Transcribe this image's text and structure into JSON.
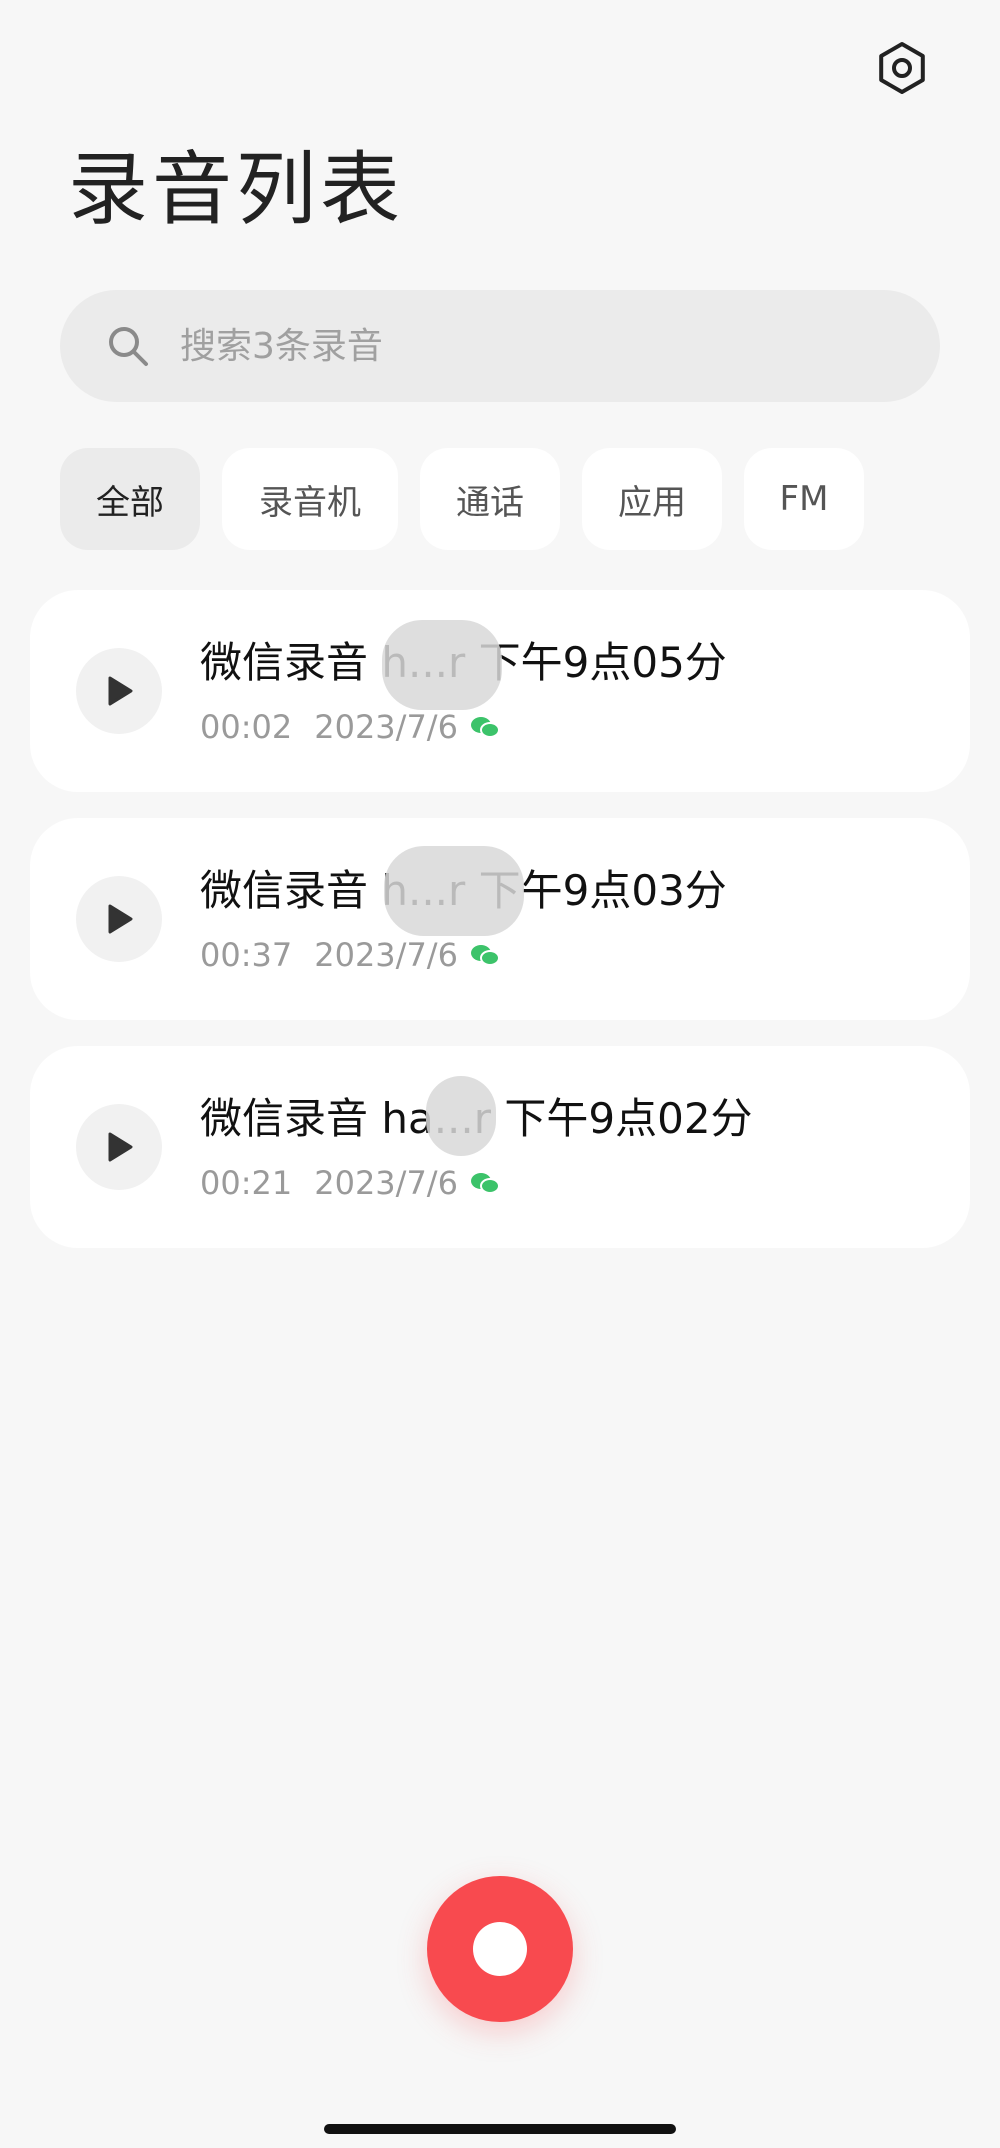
{
  "header": {
    "title": "录音列表",
    "settings_icon": "gear-icon"
  },
  "search": {
    "placeholder": "搜索3条录音",
    "icon": "search-icon"
  },
  "filters": [
    {
      "label": "全部",
      "active": true
    },
    {
      "label": "录音机",
      "active": false
    },
    {
      "label": "通话",
      "active": false
    },
    {
      "label": "应用",
      "active": false
    },
    {
      "label": "FM",
      "active": false
    }
  ],
  "recordings": [
    {
      "title": "微信录音 h...r 下午9点05分",
      "duration": "00:02",
      "date": "2023/7/6",
      "source_icon": "wechat-icon"
    },
    {
      "title": "微信录音 h...r 下午9点03分",
      "duration": "00:37",
      "date": "2023/7/6",
      "source_icon": "wechat-icon"
    },
    {
      "title": "微信录音 ha...r 下午9点02分",
      "duration": "00:21",
      "date": "2023/7/6",
      "source_icon": "wechat-icon"
    }
  ],
  "colors": {
    "accent": "#f84a4f",
    "wechat": "#3cc36a",
    "background": "#f7f7f7"
  }
}
